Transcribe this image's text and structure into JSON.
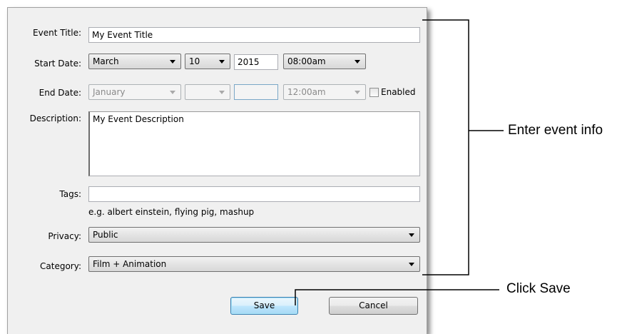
{
  "form": {
    "event_title": {
      "label": "Event Title:",
      "value": "My Event Title"
    },
    "start_date": {
      "label": "Start Date:",
      "month": "March",
      "day": "10",
      "year": "2015",
      "time": "08:00am"
    },
    "end_date": {
      "label": "End Date:",
      "month": "January",
      "day": "",
      "year": "",
      "time": "12:00am",
      "enabled_label": "Enabled",
      "enabled_checked": false
    },
    "description": {
      "label": "Description:",
      "value": "My Event Description"
    },
    "tags": {
      "label": "Tags:",
      "value": "",
      "hint": "e.g. albert einstein, flying pig, mashup"
    },
    "privacy": {
      "label": "Privacy:",
      "value": "Public"
    },
    "category": {
      "label": "Category:",
      "value": "Film + Animation"
    }
  },
  "buttons": {
    "save": "Save",
    "cancel": "Cancel"
  },
  "annotations": {
    "enter_info": "Enter event info",
    "click_save": "Click Save"
  }
}
